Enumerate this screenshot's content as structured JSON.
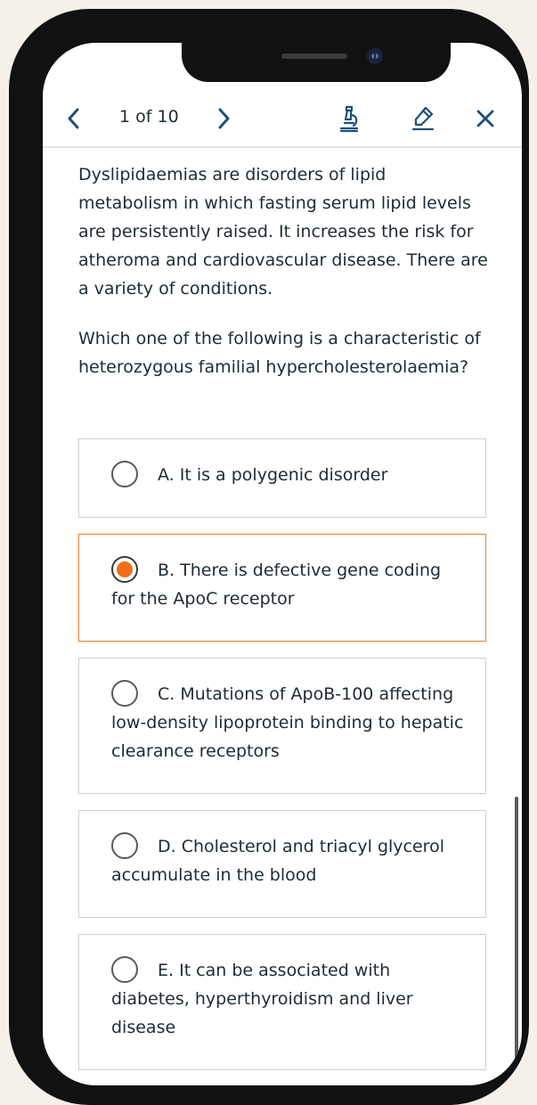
{
  "header": {
    "counter": "1 of 10",
    "icons": {
      "prev": "chevron-left-icon",
      "next": "chevron-right-icon",
      "lab": "microscope-icon",
      "highlight": "highlighter-icon",
      "close": "close-icon"
    }
  },
  "question": {
    "stem": "Dyslipidaemias are disorders of lipid metabolism in which fasting serum lipid levels are persistently raised. It increases the risk for atheroma and cardiovascular disease. There are a variety of conditions.",
    "prompt": "Which one of the following is a characteristic of heterozygous familial hypercholesterolaemia?"
  },
  "options": [
    {
      "label": "A. It is a polygenic disorder",
      "selected": false
    },
    {
      "label": "B. There is defective gene coding for the ApoC receptor",
      "selected": true
    },
    {
      "label": "C. Mutations of ApoB-100 affecting low-density lipoprotein binding to hepatic clearance receptors",
      "selected": false
    },
    {
      "label": "D. Cholesterol and triacyl glycerol accumulate in the blood",
      "selected": false
    },
    {
      "label": "E. It can be associated with diabetes, hyperthyroidism and liver disease",
      "selected": false
    }
  ],
  "colors": {
    "accent": "#f06e19",
    "selected_border": "#f0802b",
    "nav_icon": "#1e4f7a",
    "text": "#1f2b33"
  }
}
